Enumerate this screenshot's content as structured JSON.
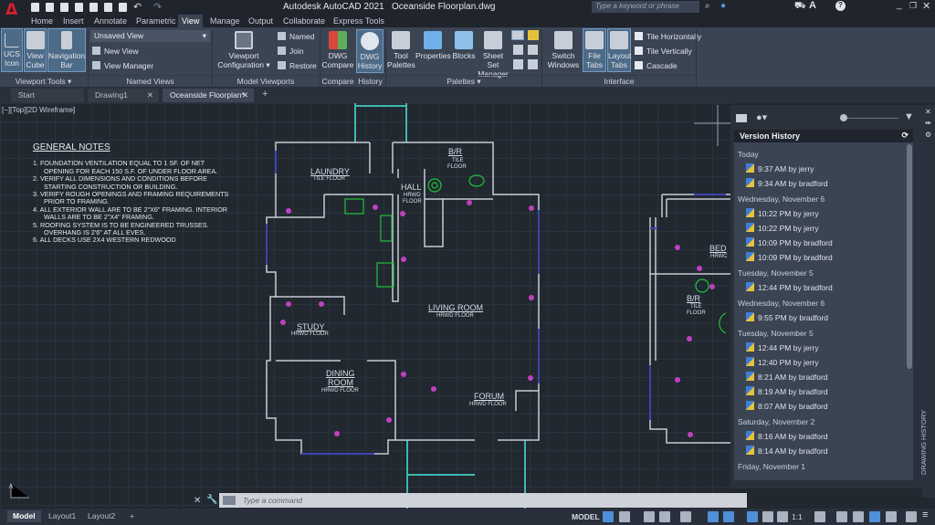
{
  "app": {
    "title": "Autodesk AutoCAD 2021",
    "document": "Oceanside Floorplan.dwg",
    "search_placeholder": "Type a keyword or phrase"
  },
  "menu_tabs": [
    "Home",
    "Insert",
    "Annotate",
    "Parametric",
    "View",
    "Manage",
    "Output",
    "Collaborate",
    "Express Tools"
  ],
  "active_menu_tab": "View",
  "ribbon": {
    "viewport_tools": {
      "label": "Viewport Tools",
      "buttons": [
        "UCS Icon",
        "View Cube",
        "Navigation Bar"
      ]
    },
    "named_views": {
      "label": "Named Views",
      "dropdown": "Unsaved View",
      "items": [
        "New View",
        "View Manager"
      ]
    },
    "model_viewports": {
      "label": "Model Viewports",
      "config": "Viewport Configuration",
      "items": [
        "Named",
        "Join",
        "Restore"
      ]
    },
    "compare": {
      "label": "Compare",
      "button": "DWG Compare"
    },
    "history": {
      "label": "History",
      "button": "DWG History"
    },
    "palettes": {
      "label": "Palettes",
      "buttons": [
        "Tool Palettes",
        "Properties",
        "Blocks",
        "Sheet Set Manager"
      ]
    },
    "interface": {
      "label": "Interface",
      "buttons": [
        "Switch Windows",
        "File Tabs",
        "Layout Tabs"
      ],
      "items": [
        "Tile Horizontally",
        "Tile Vertically",
        "Cascade"
      ]
    }
  },
  "file_tabs": [
    "Start",
    "Drawing1",
    "Oceanside Floorplan*"
  ],
  "viewport_label": "[−][Top][2D Wireframe]",
  "notes": {
    "title": "GENERAL NOTES",
    "items": [
      "1.  FOUNDATION VENTILATION EQUAL TO 1 SF. OF NET OPENING FOR EACH 150 S.F. OF UNDER FLOOR AREA.",
      "2.  VERIFY ALL DIMENSIONS AND CONDITIONS BEFORE STARTING CONSTRUCTION OR BUILDING.",
      "3.  VERIFY ROUGH OPENINGS AND FRAMING REQUIREMENTS PRIOR TO FRAMING.",
      "4.  ALL EXTERIOR WALL ARE TO BE 2\"X6\" FRAMING. INTERIOR WALLS ARE TO BE 2\"X4\" FRAMING.",
      "5.  ROOFING SYSTEM IS TO BE ENGINEERED TRUSSES. OVERHANG IS 2'6\" AT ALL EVES.",
      "6.  ALL DECKS USE 2X4 WESTERN REDWOOD"
    ]
  },
  "rooms": {
    "laundry": "LAUNDRY",
    "tile": "TILE FLOOR",
    "br": "B/R",
    "tile2": "TILE",
    "floor": "FLOOR",
    "hall": "HALL",
    "hrwd": "HRWD",
    "living": "LIVING ROOM",
    "hrwd_floor": "HRWD FLOOR",
    "study": "STUDY",
    "dining": "DINING",
    "room": "ROOM",
    "forum": "FORUM",
    "bed": "BED",
    "hrwc": "HRWC"
  },
  "version_history": {
    "title": "Version History",
    "side_label": "DRAWING HISTORY",
    "groups": [
      {
        "date": "Today",
        "versions": [
          "9:37 AM by jerry",
          "9:34 AM by bradford"
        ]
      },
      {
        "date": "Wednesday, November 6",
        "versions": [
          "10:22 PM by jerry",
          "10:22 PM by jerry",
          "10:09 PM by bradford",
          "10:09 PM by bradford"
        ]
      },
      {
        "date": "Tuesday, November 5",
        "versions": [
          "12:44 PM by bradford"
        ]
      },
      {
        "date": "Wednesday, November 6",
        "versions": [
          "9:55 PM by bradford"
        ]
      },
      {
        "date": "Tuesday, November 5",
        "versions": [
          "12:44 PM by jerry",
          "12:40 PM by jerry",
          "8:21 AM by bradford",
          "8:19 AM by bradford",
          "8:07 AM by bradford"
        ]
      },
      {
        "date": "Saturday, November 2",
        "versions": [
          "8:16 AM by bradford",
          "8:14 AM by bradford"
        ]
      },
      {
        "date": "Friday, November 1",
        "versions": []
      }
    ]
  },
  "command": {
    "placeholder": "Type a command"
  },
  "layout_tabs": [
    "Model",
    "Layout1",
    "Layout2"
  ],
  "status": {
    "model": "MODEL",
    "scale": "1:1"
  },
  "colors": {
    "accent": "#4f8fd8",
    "ribbon": "#3b4453",
    "canvas": "#212830",
    "walls": "#c8ccd2",
    "fixtures": "#22c23a",
    "markers": "#c040c0"
  }
}
